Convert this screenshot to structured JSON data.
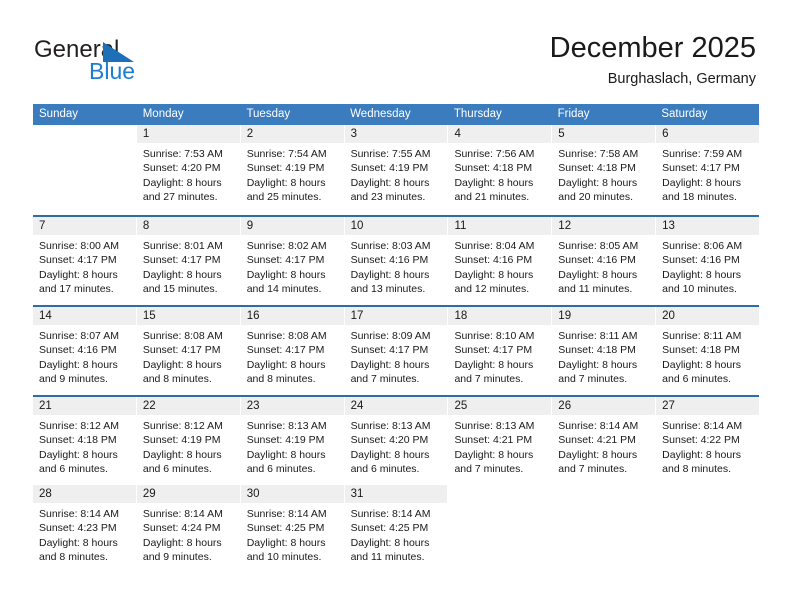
{
  "brand": {
    "name_primary": "General",
    "name_secondary": "Blue",
    "accent_color": "#1d7dd1",
    "triangle_color": "#1d6fb8"
  },
  "header": {
    "title": "December 2025",
    "subtitle": "Burghaslach, Germany"
  },
  "theme": {
    "header_bar_color": "#3a7cbe",
    "week_rule_color": "#2e6da4",
    "daynum_band_color": "#efefef",
    "text_color": "#1a1a1a"
  },
  "weekdays": [
    "Sunday",
    "Monday",
    "Tuesday",
    "Wednesday",
    "Thursday",
    "Friday",
    "Saturday"
  ],
  "labels": {
    "sunrise_prefix": "Sunrise:",
    "sunset_prefix": "Sunset:",
    "daylight_prefix": "Daylight:"
  },
  "weeks": [
    [
      {
        "day": "",
        "blank": true,
        "l1": "",
        "l2": "",
        "l3": "",
        "l4": ""
      },
      {
        "day": "1",
        "l1": "Sunrise: 7:53 AM",
        "l2": "Sunset: 4:20 PM",
        "l3": "Daylight: 8 hours",
        "l4": "and 27 minutes."
      },
      {
        "day": "2",
        "l1": "Sunrise: 7:54 AM",
        "l2": "Sunset: 4:19 PM",
        "l3": "Daylight: 8 hours",
        "l4": "and 25 minutes."
      },
      {
        "day": "3",
        "l1": "Sunrise: 7:55 AM",
        "l2": "Sunset: 4:19 PM",
        "l3": "Daylight: 8 hours",
        "l4": "and 23 minutes."
      },
      {
        "day": "4",
        "l1": "Sunrise: 7:56 AM",
        "l2": "Sunset: 4:18 PM",
        "l3": "Daylight: 8 hours",
        "l4": "and 21 minutes."
      },
      {
        "day": "5",
        "l1": "Sunrise: 7:58 AM",
        "l2": "Sunset: 4:18 PM",
        "l3": "Daylight: 8 hours",
        "l4": "and 20 minutes."
      },
      {
        "day": "6",
        "l1": "Sunrise: 7:59 AM",
        "l2": "Sunset: 4:17 PM",
        "l3": "Daylight: 8 hours",
        "l4": "and 18 minutes."
      }
    ],
    [
      {
        "day": "7",
        "l1": "Sunrise: 8:00 AM",
        "l2": "Sunset: 4:17 PM",
        "l3": "Daylight: 8 hours",
        "l4": "and 17 minutes."
      },
      {
        "day": "8",
        "l1": "Sunrise: 8:01 AM",
        "l2": "Sunset: 4:17 PM",
        "l3": "Daylight: 8 hours",
        "l4": "and 15 minutes."
      },
      {
        "day": "9",
        "l1": "Sunrise: 8:02 AM",
        "l2": "Sunset: 4:17 PM",
        "l3": "Daylight: 8 hours",
        "l4": "and 14 minutes."
      },
      {
        "day": "10",
        "l1": "Sunrise: 8:03 AM",
        "l2": "Sunset: 4:16 PM",
        "l3": "Daylight: 8 hours",
        "l4": "and 13 minutes."
      },
      {
        "day": "11",
        "l1": "Sunrise: 8:04 AM",
        "l2": "Sunset: 4:16 PM",
        "l3": "Daylight: 8 hours",
        "l4": "and 12 minutes."
      },
      {
        "day": "12",
        "l1": "Sunrise: 8:05 AM",
        "l2": "Sunset: 4:16 PM",
        "l3": "Daylight: 8 hours",
        "l4": "and 11 minutes."
      },
      {
        "day": "13",
        "l1": "Sunrise: 8:06 AM",
        "l2": "Sunset: 4:16 PM",
        "l3": "Daylight: 8 hours",
        "l4": "and 10 minutes."
      }
    ],
    [
      {
        "day": "14",
        "l1": "Sunrise: 8:07 AM",
        "l2": "Sunset: 4:16 PM",
        "l3": "Daylight: 8 hours",
        "l4": "and 9 minutes."
      },
      {
        "day": "15",
        "l1": "Sunrise: 8:08 AM",
        "l2": "Sunset: 4:17 PM",
        "l3": "Daylight: 8 hours",
        "l4": "and 8 minutes."
      },
      {
        "day": "16",
        "l1": "Sunrise: 8:08 AM",
        "l2": "Sunset: 4:17 PM",
        "l3": "Daylight: 8 hours",
        "l4": "and 8 minutes."
      },
      {
        "day": "17",
        "l1": "Sunrise: 8:09 AM",
        "l2": "Sunset: 4:17 PM",
        "l3": "Daylight: 8 hours",
        "l4": "and 7 minutes."
      },
      {
        "day": "18",
        "l1": "Sunrise: 8:10 AM",
        "l2": "Sunset: 4:17 PM",
        "l3": "Daylight: 8 hours",
        "l4": "and 7 minutes."
      },
      {
        "day": "19",
        "l1": "Sunrise: 8:11 AM",
        "l2": "Sunset: 4:18 PM",
        "l3": "Daylight: 8 hours",
        "l4": "and 7 minutes."
      },
      {
        "day": "20",
        "l1": "Sunrise: 8:11 AM",
        "l2": "Sunset: 4:18 PM",
        "l3": "Daylight: 8 hours",
        "l4": "and 6 minutes."
      }
    ],
    [
      {
        "day": "21",
        "l1": "Sunrise: 8:12 AM",
        "l2": "Sunset: 4:18 PM",
        "l3": "Daylight: 8 hours",
        "l4": "and 6 minutes."
      },
      {
        "day": "22",
        "l1": "Sunrise: 8:12 AM",
        "l2": "Sunset: 4:19 PM",
        "l3": "Daylight: 8 hours",
        "l4": "and 6 minutes."
      },
      {
        "day": "23",
        "l1": "Sunrise: 8:13 AM",
        "l2": "Sunset: 4:19 PM",
        "l3": "Daylight: 8 hours",
        "l4": "and 6 minutes."
      },
      {
        "day": "24",
        "l1": "Sunrise: 8:13 AM",
        "l2": "Sunset: 4:20 PM",
        "l3": "Daylight: 8 hours",
        "l4": "and 6 minutes."
      },
      {
        "day": "25",
        "l1": "Sunrise: 8:13 AM",
        "l2": "Sunset: 4:21 PM",
        "l3": "Daylight: 8 hours",
        "l4": "and 7 minutes."
      },
      {
        "day": "26",
        "l1": "Sunrise: 8:14 AM",
        "l2": "Sunset: 4:21 PM",
        "l3": "Daylight: 8 hours",
        "l4": "and 7 minutes."
      },
      {
        "day": "27",
        "l1": "Sunrise: 8:14 AM",
        "l2": "Sunset: 4:22 PM",
        "l3": "Daylight: 8 hours",
        "l4": "and 8 minutes."
      }
    ],
    [
      {
        "day": "28",
        "l1": "Sunrise: 8:14 AM",
        "l2": "Sunset: 4:23 PM",
        "l3": "Daylight: 8 hours",
        "l4": "and 8 minutes."
      },
      {
        "day": "29",
        "l1": "Sunrise: 8:14 AM",
        "l2": "Sunset: 4:24 PM",
        "l3": "Daylight: 8 hours",
        "l4": "and 9 minutes."
      },
      {
        "day": "30",
        "l1": "Sunrise: 8:14 AM",
        "l2": "Sunset: 4:25 PM",
        "l3": "Daylight: 8 hours",
        "l4": "and 10 minutes."
      },
      {
        "day": "31",
        "l1": "Sunrise: 8:14 AM",
        "l2": "Sunset: 4:25 PM",
        "l3": "Daylight: 8 hours",
        "l4": "and 11 minutes."
      },
      {
        "day": "",
        "blank": true,
        "l1": "",
        "l2": "",
        "l3": "",
        "l4": ""
      },
      {
        "day": "",
        "blank": true,
        "l1": "",
        "l2": "",
        "l3": "",
        "l4": ""
      },
      {
        "day": "",
        "blank": true,
        "l1": "",
        "l2": "",
        "l3": "",
        "l4": ""
      }
    ]
  ]
}
